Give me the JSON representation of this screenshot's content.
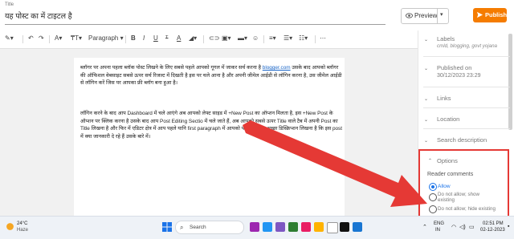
{
  "header": {
    "title_caption": "Title",
    "post_title": "यह पोस्ट का में टाइटल है",
    "preview_label": "Preview",
    "publish_label": "Publish"
  },
  "toolbar": {
    "paragraph_label": "Paragraph",
    "more_label": "⋯"
  },
  "editor": {
    "para1_part1": "ब्लॉगर पर अपना पहला ब्लॉक पोस्ट लिखने के लिए सबसे पहले आपको गूगल में जाकर सर्च करना है ",
    "para1_link": "blogger.com",
    "para1_part2": " उसके बाद आपको ब्लॉगर की ऑफिशल वेबसाइट सबसे ऊपर सर्च रिजल्ट में दिखती है इस पर चले आना है और अपनी जीमेल आईडी से लॉगिन करना है, उस जीमेल आईडी से लॉगिन करें जिस पर आपका फ्री ब्लॉग बना हुआ है।",
    "para2": "लॉगिन करने के बाद आप Dashboard में चले आएंगे अब आपको लेफ्ट साइड में +New Post का ऑप्शन मिलता है, इस +New Post के ऑप्शन पर क्लिक करना है उसके बाद आप Post Editing Sectio में चले जाते हैं, अब आपको सबसे ऊपर Title वाले टैब में अपनी Post का Title लिखना है और फिर में एडिटर क्षेत्र में आप पहले यानि first paragraph में आपको पोस्ट का एक अच्छा डिस्क्रिप्शन लिखना है कि इस post में क्या जानकारी दे रहे हैं उसके बारे में।"
  },
  "sidebar": {
    "labels_title": "Labels",
    "labels_value": "cmld, blogging, govt yojana",
    "published_title": "Published on",
    "published_value": "30/12/2023 23:29",
    "links": "Links",
    "location": "Location",
    "search_description": "Search description",
    "options": "Options",
    "reader_comments": "Reader comments",
    "radio_allow": "Allow",
    "radio_no_show_1": "Do not allow; show",
    "radio_no_show_2": "existing",
    "radio_no_hide": "Do not allow; hide existing"
  },
  "taskbar": {
    "weather_temp": "24°C",
    "weather_desc": "Haze",
    "search_label": "Search",
    "lang_1": "ENG",
    "lang_2": "IN",
    "time": "02:51 PM",
    "date": "02-12-2023"
  },
  "colors": {
    "publish": "#f57c00",
    "link": "#1a66c8",
    "arrow": "#e53935",
    "radio_selected": "#1a73e8"
  }
}
